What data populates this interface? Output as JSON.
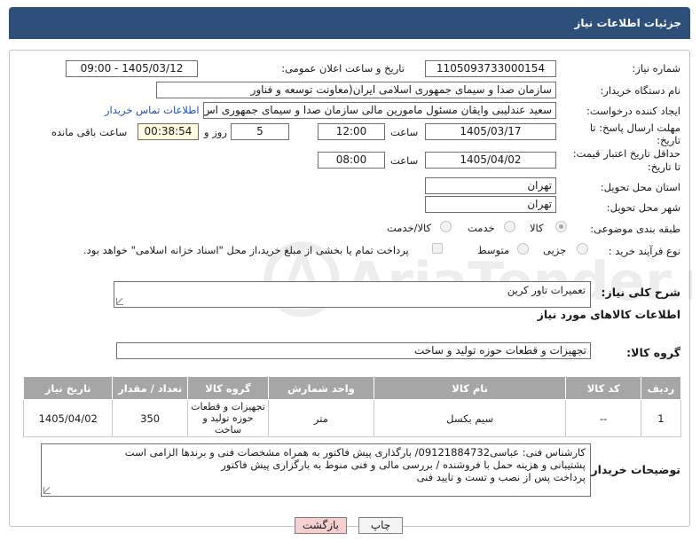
{
  "window": {
    "title": "جزئیات اطلاعات نیاز"
  },
  "watermark": {
    "text": "AriaTender.net"
  },
  "form": {
    "need_number": {
      "label": "شماره نیاز:",
      "value": "1105093733000154"
    },
    "announce_datetime": {
      "label": "تاریخ و ساعت اعلان عمومی:",
      "value": "1405/03/12 - 09:00"
    },
    "buyer_org": {
      "label": "نام دستگاه خریدار:",
      "value": "سازمان صدا و سیمای جمهوری اسلامی ایران(معاونت توسعه و فناور"
    },
    "requester": {
      "label": "ایجاد کننده درخواست:",
      "value": "سعید عندلیبی وایقان مسئول مامورین مالی  سازمان صدا و سیمای جمهوری اس",
      "contact_link": "اطلاعات تماس خریدار"
    },
    "reply_deadline": {
      "label_line1": "مهلت ارسال پاسخ: تا",
      "label_line2": "تاریخ:",
      "date": "1405/03/17",
      "time_label": "ساعت",
      "time": "12:00",
      "days": "5",
      "days_label": "روز و",
      "remaining": "00:38:54",
      "remaining_label": "ساعت باقی مانده"
    },
    "price_validity": {
      "label_line1": "حداقل تاریخ اعتبار قیمت:",
      "label_line2": "تا تاریخ:",
      "date": "1405/04/02",
      "time_label": "ساعت",
      "time": "08:00"
    },
    "delivery_province": {
      "label": "استان محل تحویل:",
      "value": "تهران"
    },
    "delivery_city": {
      "label": "شهر محل تحویل:",
      "value": "تهران"
    },
    "category": {
      "label": "طبقه بندی موضوعی:",
      "options": [
        "کالا",
        "خدمت",
        "کالا/خدمت"
      ],
      "selected": "کالا"
    },
    "purchase_process": {
      "label": "نوع فرآیند خرید :",
      "options": [
        "جزیی",
        "متوسط"
      ],
      "payment_note": "پرداخت تمام یا بخشی از مبلغ خرید،از محل \"اسناد خزانه اسلامی\" خواهد بود."
    }
  },
  "general_description": {
    "label": "شرح کلی نیاز:",
    "value": "تعمیرات تاور کرین"
  },
  "goods_section": {
    "title": "اطلاعات کالاهای مورد نیاز",
    "group_label": "گروه کالا:",
    "group_value": "تجهیزات و قطعات حوزه تولید و ساخت"
  },
  "items_table": {
    "columns": [
      "ردیف",
      "کد کالا",
      "نام کالا",
      "واحد شمارش",
      "گروه کالا",
      "تعداد / مقدار",
      "تاریخ نیاز"
    ],
    "rows": [
      [
        "1",
        "--",
        "سیم بکسل",
        "متر",
        "تجهیزات و قطعات حوزه تولید و ساخت",
        "350",
        "1405/04/02"
      ]
    ]
  },
  "buyer_notes": {
    "label": "توضیحات خریدار:",
    "lines": [
      "کارشناس فنی: عباسی09121884732/ بارگذاری پیش فاکتور به همراه مشخصات فنی و برندها الزامی است",
      "پشتیبانی و هزینه حمل با فروشنده / بررسی مالی و فنی منوط به بارگزاری پیش فاکتور",
      "پرداخت پس از نصب و تست و تایید فنی"
    ]
  },
  "buttons": {
    "print": "چاپ",
    "back": "بازگشت"
  }
}
